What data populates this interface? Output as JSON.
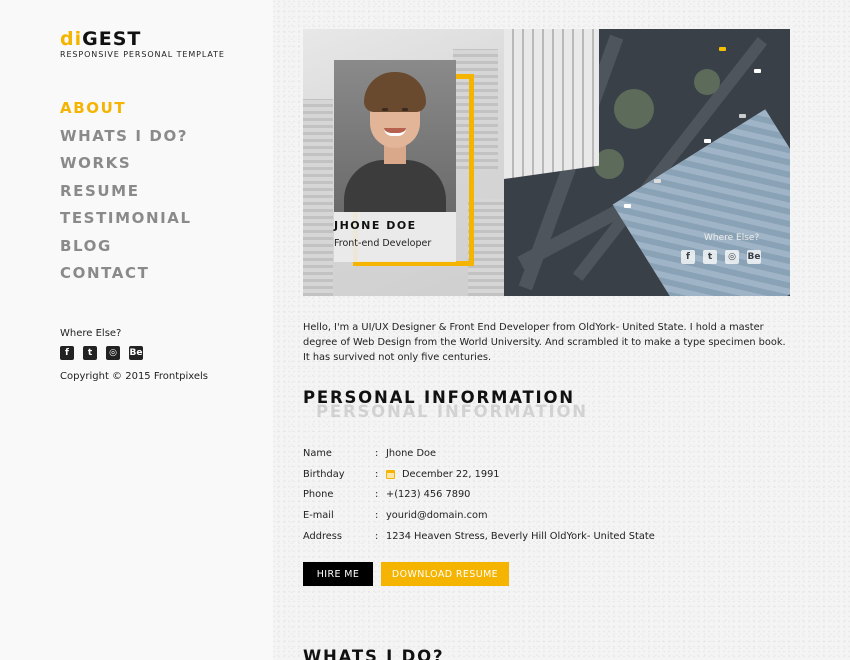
{
  "brand": {
    "logo_mark": "di",
    "logo_text": "GEST",
    "tagline": "RESPONSIVE PERSONAL TEMPLATE",
    "accent": "#f5b400"
  },
  "nav": {
    "items": [
      "ABOUT",
      "WHATS I DO?",
      "WORKS",
      "RESUME",
      "TESTIMONIAL",
      "BLOG",
      "CONTACT"
    ],
    "active": "ABOUT"
  },
  "sidebar": {
    "where_label": "Where Else?",
    "social": [
      "facebook-icon",
      "twitter-icon",
      "instagram-icon",
      "behance-icon"
    ],
    "copyright": "Copyright © 2015 Frontpixels"
  },
  "hero": {
    "name": "JHONE DOE",
    "role": "Front-end Developer",
    "where_label": "Where Else?",
    "social": [
      "facebook-icon",
      "twitter-icon",
      "instagram-icon",
      "behance-icon"
    ]
  },
  "intro": "Hello, I'm a UI/UX Designer & Front End Developer from OldYork- United State. I hold a master degree of Web Design from the World University. And scrambled it to make a type specimen book. It has survived not only five centuries.",
  "personal": {
    "title": "PERSONAL INFORMATION",
    "rows": [
      {
        "label": "Name",
        "value": "Jhone Doe"
      },
      {
        "label": "Birthday",
        "value": "December 22, 1991"
      },
      {
        "label": "Phone",
        "value": "+(123) 456 7890"
      },
      {
        "label": "E-mail",
        "value": "yourid@domain.com"
      },
      {
        "label": "Address",
        "value": "1234 Heaven Stress, Beverly Hill OldYork- United State"
      }
    ],
    "separator": ":"
  },
  "buttons": {
    "hire": "HIRE ME",
    "download": "DOWNLOAD RESUME"
  },
  "next_section_title": "WHATS I DO?"
}
